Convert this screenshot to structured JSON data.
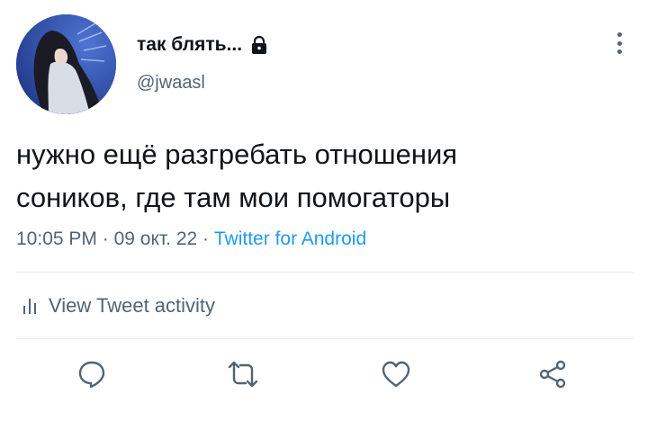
{
  "author": {
    "display_name": "так блять...",
    "handle": "@jwaasl",
    "protected_icon": "lock-icon",
    "avatar": "anime-avatar-image"
  },
  "tweet": {
    "text_line1": "нужно ещё разгребать отношения",
    "text_line2": "соников, где там мои помогаторы",
    "time": "10:05 PM",
    "separator": "·",
    "date": "09 окт. 22",
    "source": "Twitter for Android"
  },
  "activity": {
    "label": "View Tweet activity",
    "icon": "bar-chart-icon"
  },
  "actions": [
    {
      "name": "reply",
      "icon": "reply-icon"
    },
    {
      "name": "retweet",
      "icon": "retweet-icon"
    },
    {
      "name": "like",
      "icon": "heart-icon"
    },
    {
      "name": "share",
      "icon": "share-icon"
    }
  ],
  "colors": {
    "text": "#0f1419",
    "secondary": "#536471",
    "link": "#1d9bf0",
    "divider": "#e6ecf0"
  }
}
